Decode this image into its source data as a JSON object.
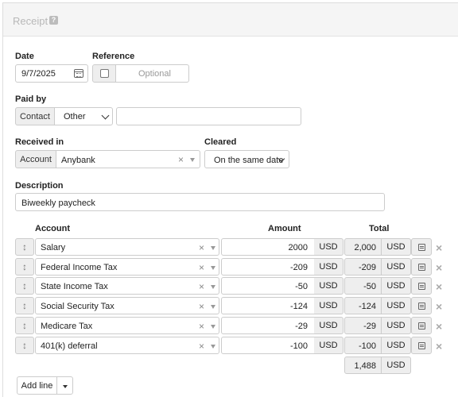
{
  "panel": {
    "title": "Receipt",
    "help_badge": "?"
  },
  "date": {
    "label": "Date",
    "value": "9/7/2025"
  },
  "reference": {
    "label": "Reference",
    "placeholder": "Optional",
    "checked": false
  },
  "paid_by": {
    "label": "Paid by",
    "addon": "Contact",
    "type_value": "Other",
    "text_value": ""
  },
  "received_in": {
    "label": "Received in",
    "addon": "Account",
    "value": "Anybank"
  },
  "cleared": {
    "label": "Cleared",
    "value": "On the same date"
  },
  "description": {
    "label": "Description",
    "value": "Biweekly paycheck"
  },
  "lines": {
    "headers": {
      "account": "Account",
      "amount": "Amount",
      "total": "Total"
    },
    "currency": "USD",
    "rows": [
      {
        "account": "Salary",
        "amount": "2000",
        "total": "2,000"
      },
      {
        "account": "Federal Income Tax",
        "amount": "-209",
        "total": "-209"
      },
      {
        "account": "State Income Tax",
        "amount": "-50",
        "total": "-50"
      },
      {
        "account": "Social Security Tax",
        "amount": "-124",
        "total": "-124"
      },
      {
        "account": "Medicare Tax",
        "amount": "-29",
        "total": "-29"
      },
      {
        "account": "401(k) deferral",
        "amount": "-100",
        "total": "-100"
      }
    ],
    "grand_total": "1,488"
  },
  "actions": {
    "add_line": "Add line"
  },
  "icons": {
    "calendar": "calendar-icon",
    "drag": "drag-handle-icon",
    "clear": "clear-x-icon",
    "caret": "caret-down-icon",
    "memo": "memo-icon",
    "remove": "remove-x-icon"
  }
}
